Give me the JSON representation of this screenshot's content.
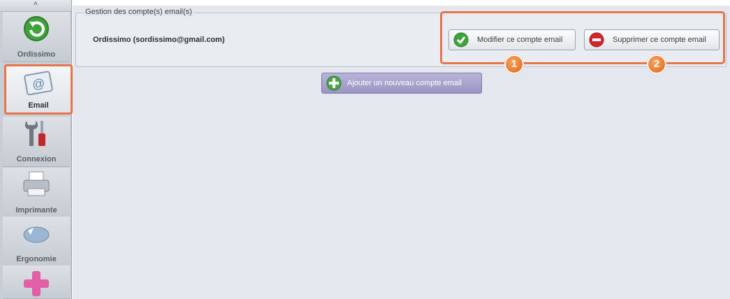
{
  "sidebar": {
    "scroll_up_glyph": "^",
    "items": [
      {
        "label": "Ordissimo",
        "icon": "refresh-icon"
      },
      {
        "label": "Email",
        "icon": "email-icon",
        "active": true
      },
      {
        "label": "Connexion",
        "icon": "tools-icon"
      },
      {
        "label": "Imprimante",
        "icon": "printer-icon"
      },
      {
        "label": "Ergonomie",
        "icon": "mouse-icon"
      },
      {
        "label": "",
        "icon": "plus-icon"
      }
    ]
  },
  "main": {
    "group_title": "Gestion des compte(s) email(s)",
    "account_name": "Ordissimo (sordissimo@gmail.com)",
    "modify_button": "Modifier ce compte email",
    "delete_button": "Supprimer ce compte email",
    "add_button": "Ajouter un nouveau compte email",
    "badge_1": "1",
    "badge_2": "2"
  },
  "colors": {
    "highlight": "#e8744a",
    "background": "#e4e8ee",
    "sidebar": "#c9ced6"
  }
}
